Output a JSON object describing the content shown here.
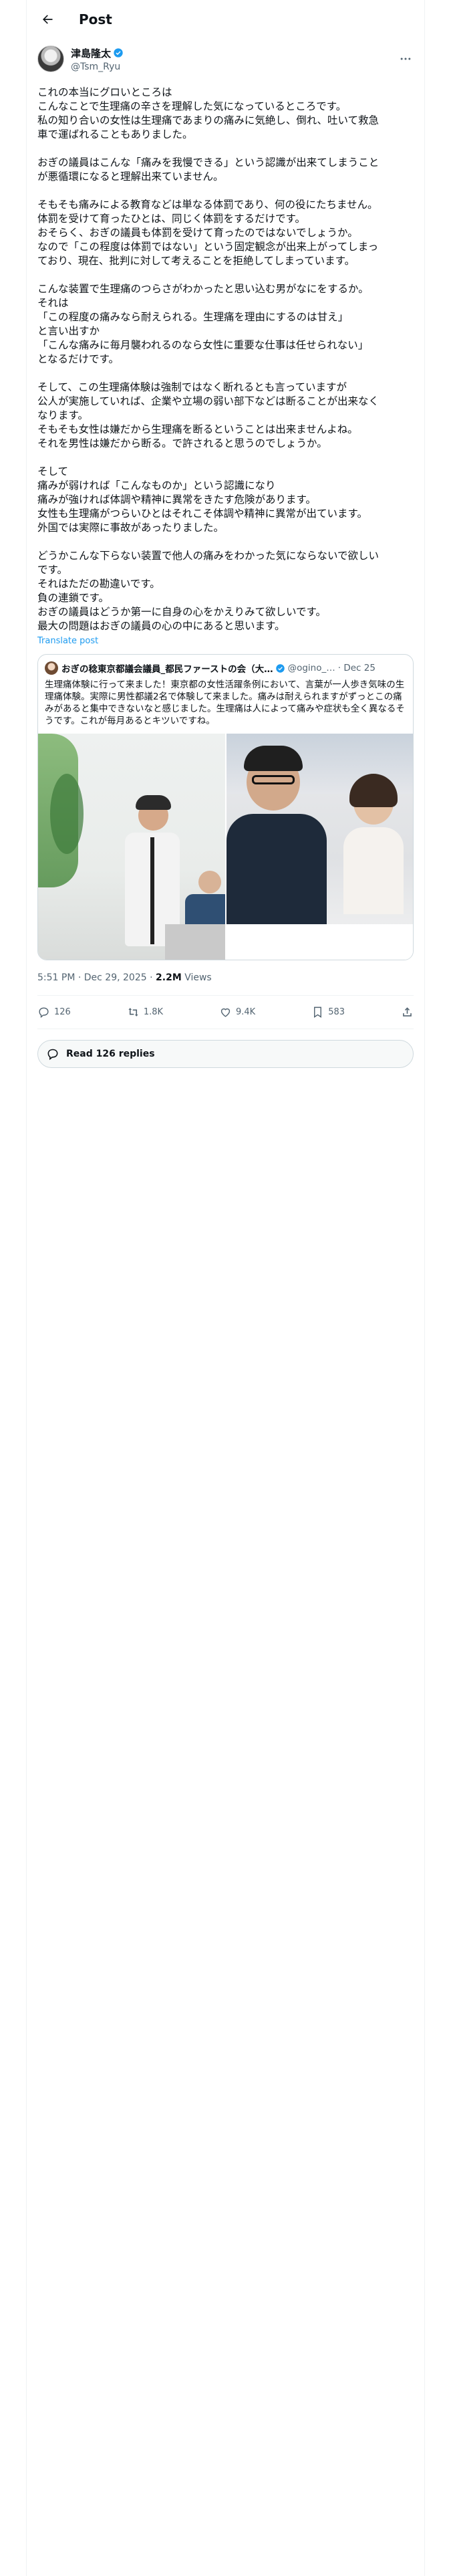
{
  "header": {
    "title": "Post"
  },
  "author": {
    "name": "津島隆太",
    "handle": "@Tsm_Ryu"
  },
  "post": {
    "paragraphs": [
      [
        "これの本当にグロいところは",
        "こんなことで生理痛の辛さを理解した気になっているところです。",
        "私の知り合いの女性は生理痛であまりの痛みに気絶し、倒れ、吐いて救急",
        "車で運ばれることもありました。"
      ],
      [
        "おぎの議員はこんな「痛みを我慢できる」という認識が出来てしまうこと",
        "が悪循環になると理解出来ていません。"
      ],
      [
        "そもそも痛みによる教育などは単なる体罰であり、何の役にたちません。",
        "体罰を受けて育ったひとは、同じく体罰をするだけです。",
        "おそらく、おぎの議員も体罰を受けて育ったのではないでしょうか。",
        "なので「この程度は体罰ではない」という固定観念が出来上がってしまっ",
        "ており、現在、批判に対して考えることを拒絶してしまっています。"
      ],
      [
        "こんな装置で生理痛のつらさがわかったと思い込む男がなにをするか。",
        "それは",
        "「この程度の痛みなら耐えられる。生理痛を理由にするのは甘え」",
        "と言い出すか",
        "「こんな痛みに毎月襲われるのなら女性に重要な仕事は任せられない」",
        "となるだけです。"
      ],
      [
        "そして、この生理痛体験は強制ではなく断れるとも言っていますが",
        "公人が実施していれば、企業や立場の弱い部下などは断ることが出来なく",
        "なります。",
        "そもそも女性は嫌だから生理痛を断るということは出来ませんよね。",
        "それを男性は嫌だから断る。で許されると思うのでしょうか。"
      ],
      [
        "そして",
        "痛みが弱ければ「こんなものか」という認識になり",
        "痛みが強ければ体調や精神に異常をきたす危険があります。",
        "女性も生理痛がつらいひとはそれこそ体調や精神に異常が出ています。",
        "外国では実際に事故があったりました。"
      ],
      [
        "どうかこんな下らない装置で他人の痛みをわかった気にならないで欲しい",
        "です。",
        "それはただの勘違いです。",
        "負の連鎖です。",
        "おぎの議員はどうか第一に自身の心をかえりみて欲しいです。",
        "最大の問題はおぎの議員の心の中にあると思います。"
      ]
    ],
    "translate_label": "Translate post",
    "timestamp": "5:51 PM · Dec 29, 2025",
    "views_count": "2.2M",
    "views_label": "Views"
  },
  "quote": {
    "name": "おぎの稔東京都議会議員_都民ファーストの会（大…",
    "handle": "@ogino_…",
    "date": "· Dec 25",
    "text": "生理痛体験に行って来ました！東京都の女性活躍条例において、言葉が一人歩き気味の生理痛体験。実際に男性都議2名で体験して来ました。痛みは耐えられますがずっとこの痛みがあると集中できないなと感じました。生理痛は人によって痛みや症状も全く異なるそうです。これが毎月あるとキツいですね。"
  },
  "actions": {
    "replies": "126",
    "reposts": "1.8K",
    "likes": "9.4K",
    "bookmarks": "583"
  },
  "read_replies_label": "Read 126 replies",
  "colors": {
    "link": "#1d9bf0",
    "muted": "#536471",
    "text": "#0f1419",
    "border": "#cfd9de"
  }
}
